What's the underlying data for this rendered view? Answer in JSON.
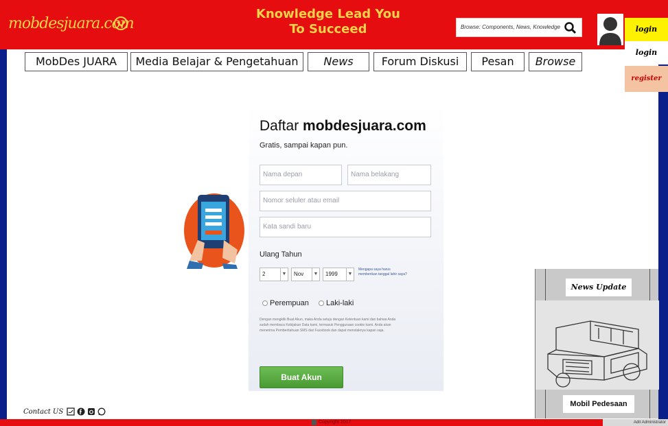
{
  "header": {
    "logo_text": "mobdesjuara.com",
    "tagline": "Knowledge Lead You To Succeed",
    "search_placeholder": "Browse: Components, News, Knowledge",
    "login_label": "login",
    "login_label_2": "login",
    "register_label": "register"
  },
  "nav": {
    "items": [
      {
        "label": "MobDes JUARA"
      },
      {
        "label": "Media Belajar & Pengetahuan"
      },
      {
        "label": "News"
      },
      {
        "label": "Forum Diskusi"
      },
      {
        "label": "Pesan"
      },
      {
        "label": "Browse"
      }
    ]
  },
  "signup": {
    "title_prefix": "Daftar",
    "title_site": "mobdesjuara.com",
    "subtitle": "Gratis, sampai kapan pun.",
    "first_name_placeholder": "Nama depan",
    "last_name_placeholder": "Nama belakang",
    "contact_placeholder": "Nomor seluler atau email",
    "password_placeholder": "Kata sandi baru",
    "birthday_label": "Ulang Tahun",
    "day": "2",
    "month": "Nov",
    "year": "1999",
    "why_text": "Mengapa saya harus memberikan tanggal lahir saya?",
    "gender_female": "Perempuan",
    "gender_male": "Laki-laki",
    "terms": "Dengan mengklik Buat Akun, maka Anda setuju dengan Ketentuan kami dan bahwa Anda sudah membaca Kebijakan Data kami, termasuk Penggunaan cookie kami. Anda akan menerima Pemberitahuan SMS dari Facebook dan dapat menolaknya kapan saja.",
    "submit_label": "Buat Akun"
  },
  "news": {
    "title": "News Update",
    "caption": "Mobil Pedesaan"
  },
  "contact": {
    "label": "Contact US"
  },
  "footer": {
    "center_text": "Copyright 2017",
    "admin_link": "Adit Administrator"
  },
  "colors": {
    "header_red": "#e50d10",
    "accent_yellow": "#f3d24a",
    "frame_blue": "#0b1f8a",
    "submit_green": "#5aaa40"
  }
}
